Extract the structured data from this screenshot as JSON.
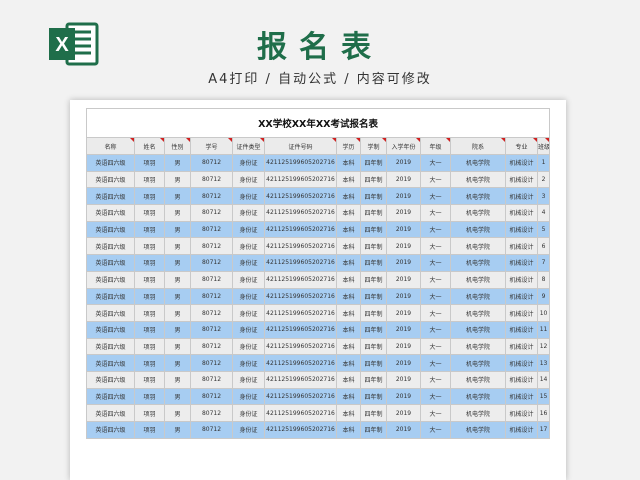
{
  "header": {
    "title": "报名表",
    "subtitle": "A4打印 / 自动公式 / 内容可修改",
    "logo_icon": "excel-icon",
    "logo_letter": "X"
  },
  "colors": {
    "brand_green": "#1f6e4a",
    "row_blue": "#a7cdf2",
    "row_gray": "#ededed",
    "header_gray": "#ebebeb",
    "marker_red": "#d02020"
  },
  "sheet": {
    "caption": "XX学校XX年XX考试报名表",
    "columns": [
      "名称",
      "姓名",
      "性别",
      "学号",
      "证件类型",
      "证件号码",
      "学历",
      "学制",
      "入学年份",
      "年级",
      "院系",
      "专业",
      "班级"
    ],
    "rows": [
      [
        "英语四六级",
        "项羽",
        "男",
        "80712",
        "身份证",
        "421125199605202716",
        "本科",
        "四年制",
        "2019",
        "大一",
        "机电学院",
        "机械设计",
        "1"
      ],
      [
        "英语四六级",
        "项羽",
        "男",
        "80712",
        "身份证",
        "421125199605202716",
        "本科",
        "四年制",
        "2019",
        "大一",
        "机电学院",
        "机械设计",
        "2"
      ],
      [
        "英语四六级",
        "项羽",
        "男",
        "80712",
        "身份证",
        "421125199605202716",
        "本科",
        "四年制",
        "2019",
        "大一",
        "机电学院",
        "机械设计",
        "3"
      ],
      [
        "英语四六级",
        "项羽",
        "男",
        "80712",
        "身份证",
        "421125199605202716",
        "本科",
        "四年制",
        "2019",
        "大一",
        "机电学院",
        "机械设计",
        "4"
      ],
      [
        "英语四六级",
        "项羽",
        "男",
        "80712",
        "身份证",
        "421125199605202716",
        "本科",
        "四年制",
        "2019",
        "大一",
        "机电学院",
        "机械设计",
        "5"
      ],
      [
        "英语四六级",
        "项羽",
        "男",
        "80712",
        "身份证",
        "421125199605202716",
        "本科",
        "四年制",
        "2019",
        "大一",
        "机电学院",
        "机械设计",
        "6"
      ],
      [
        "英语四六级",
        "项羽",
        "男",
        "80712",
        "身份证",
        "421125199605202716",
        "本科",
        "四年制",
        "2019",
        "大一",
        "机电学院",
        "机械设计",
        "7"
      ],
      [
        "英语四六级",
        "项羽",
        "男",
        "80712",
        "身份证",
        "421125199605202716",
        "本科",
        "四年制",
        "2019",
        "大一",
        "机电学院",
        "机械设计",
        "8"
      ],
      [
        "英语四六级",
        "项羽",
        "男",
        "80712",
        "身份证",
        "421125199605202716",
        "本科",
        "四年制",
        "2019",
        "大一",
        "机电学院",
        "机械设计",
        "9"
      ],
      [
        "英语四六级",
        "项羽",
        "男",
        "80712",
        "身份证",
        "421125199605202716",
        "本科",
        "四年制",
        "2019",
        "大一",
        "机电学院",
        "机械设计",
        "10"
      ],
      [
        "英语四六级",
        "项羽",
        "男",
        "80712",
        "身份证",
        "421125199605202716",
        "本科",
        "四年制",
        "2019",
        "大一",
        "机电学院",
        "机械设计",
        "11"
      ],
      [
        "英语四六级",
        "项羽",
        "男",
        "80712",
        "身份证",
        "421125199605202716",
        "本科",
        "四年制",
        "2019",
        "大一",
        "机电学院",
        "机械设计",
        "12"
      ],
      [
        "英语四六级",
        "项羽",
        "男",
        "80712",
        "身份证",
        "421125199605202716",
        "本科",
        "四年制",
        "2019",
        "大一",
        "机电学院",
        "机械设计",
        "13"
      ],
      [
        "英语四六级",
        "项羽",
        "男",
        "80712",
        "身份证",
        "421125199605202716",
        "本科",
        "四年制",
        "2019",
        "大一",
        "机电学院",
        "机械设计",
        "14"
      ],
      [
        "英语四六级",
        "项羽",
        "男",
        "80712",
        "身份证",
        "421125199605202716",
        "本科",
        "四年制",
        "2019",
        "大一",
        "机电学院",
        "机械设计",
        "15"
      ],
      [
        "英语四六级",
        "项羽",
        "男",
        "80712",
        "身份证",
        "421125199605202716",
        "本科",
        "四年制",
        "2019",
        "大一",
        "机电学院",
        "机械设计",
        "16"
      ],
      [
        "英语四六级",
        "项羽",
        "男",
        "80712",
        "身份证",
        "421125199605202716",
        "本科",
        "四年制",
        "2019",
        "大一",
        "机电学院",
        "机械设计",
        "17"
      ]
    ]
  }
}
